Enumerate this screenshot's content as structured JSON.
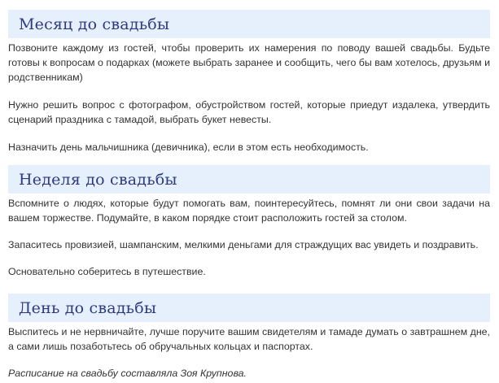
{
  "sections": [
    {
      "heading": "Месяц до свадьбы",
      "paragraphs": [
        "Позвоните каждому из гостей, чтобы проверить их намерения по поводу вашей свадьбы. Будьте готовы к вопросам о подарках (можете выбрать заранее и сообщить, чего бы вам хотелось, друзьям и родственникам)",
        "Нужно решить вопрос с фотографом, обустройством гостей, которые приедут издалека, утвердить сценарий праздника с тамадой, выбрать букет невесты.",
        "Назначить день мальчишника (девичника), если в этом есть необходимость."
      ]
    },
    {
      "heading": "Неделя до свадьбы",
      "paragraphs": [
        "Вспомните о людях, которые будут помогать вам, поинтересуйтесь, помнят ли они свои задачи на вашем торжестве. Подумайте, в каком порядке стоит расположить гостей за столом.",
        "Запаситесь провизией, шампанским, мелкими деньгами для страждущих вас увидеть и поздравить.",
        "Основательно соберитесь в путешествие."
      ]
    },
    {
      "heading": "День до свадьбы",
      "paragraphs": [
        "Выспитесь и не нервничайте, лучше поручите вашим свидетелям и тамаде думать о завтрашнем дне, а сами лишь позаботьтесь об обручальных кольцах и паспортах."
      ]
    }
  ],
  "credit": "Расписание на свадьбу составляла Зоя Крупнова."
}
